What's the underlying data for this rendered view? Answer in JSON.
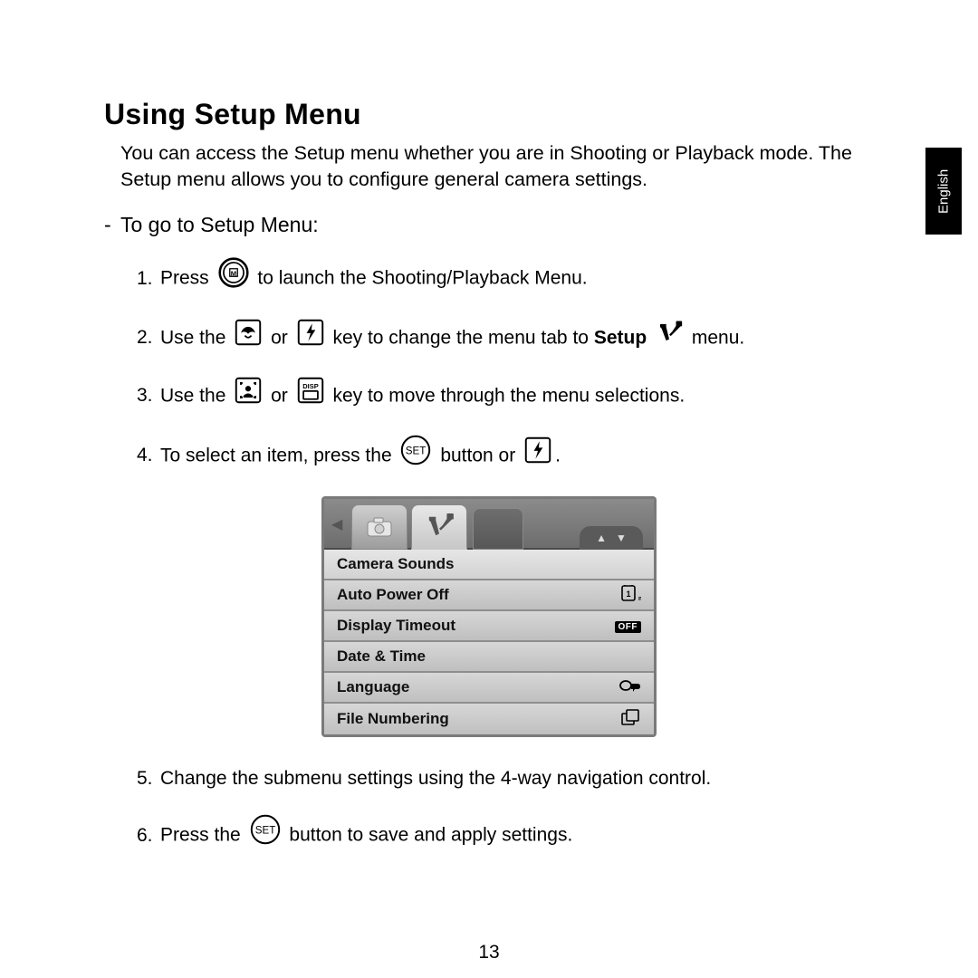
{
  "side_tab": "English",
  "title": "Using Setup Menu",
  "intro": "You can access the Setup menu whether you are in Shooting or Playback mode. The Setup menu allows you to configure general camera settings.",
  "subhead": "To go to Setup Menu:",
  "steps": {
    "s1a": "Press",
    "s1b": "to launch the Shooting/Playback Menu.",
    "s2a": "Use the",
    "s2_or": "or",
    "s2b": "key to change the menu tab to",
    "s2_setup": "Setup",
    "s2c": "menu.",
    "s3a": "Use the",
    "s3_or": "or",
    "s3b": "key to move through the menu selections.",
    "s4a": "To select an item, press the",
    "s4b": "button or",
    "s4c": ".",
    "s5": "Change the submenu settings using the 4-way navigation control.",
    "s6a": "Press the",
    "s6b": "button to save and apply settings."
  },
  "menu": {
    "items": [
      {
        "label": "Camera Sounds",
        "value": ""
      },
      {
        "label": "Auto Power Off",
        "value": "1min"
      },
      {
        "label": "Display Timeout",
        "value": "OFF"
      },
      {
        "label": "Date & Time",
        "value": ""
      },
      {
        "label": "Language",
        "value": "lang"
      },
      {
        "label": "File Numbering",
        "value": "files"
      }
    ]
  },
  "icons": {
    "disp_label": "DISP",
    "set_label": "SET"
  },
  "page_number": "13"
}
